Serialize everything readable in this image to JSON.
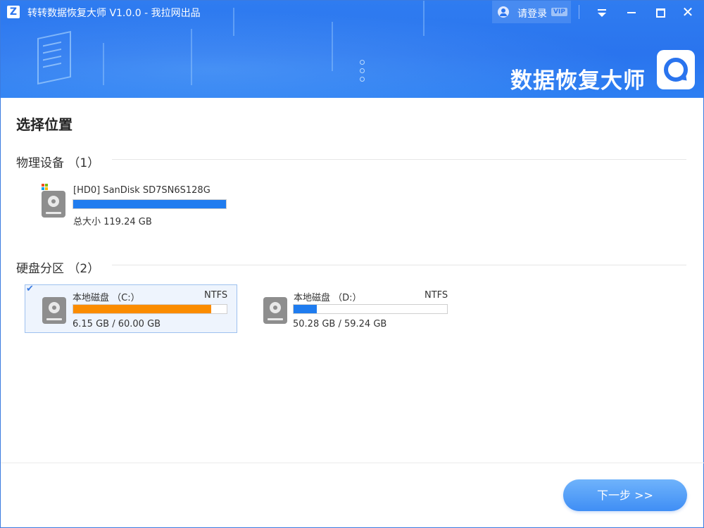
{
  "titlebar": {
    "logo_letter": "Z",
    "title": "转转数据恢复大师 V1.0.0 - 我拉网出品",
    "login_label": "请登录",
    "vip_badge": "VIP",
    "icons": [
      "menu-dropdown-icon",
      "minimize-icon",
      "maximize-icon",
      "close-icon"
    ],
    "close_glyph": "✕"
  },
  "banner": {
    "brand_text": "数据恢复大师",
    "accent_color": "#2a74ee"
  },
  "page": {
    "title": "选择位置"
  },
  "physical": {
    "section_label": "物理设备 （1）",
    "devices": [
      {
        "name": "[HD0] SanDisk SD7SN6S128G",
        "size_label": "总大小 119.24 GB",
        "used_fraction": 1.0,
        "bar_color": "#1f7cef"
      }
    ]
  },
  "partitions": {
    "section_label": "硬盘分区 （2）",
    "items": [
      {
        "name": "本地磁盘 （C:）",
        "fs": "NTFS",
        "size_label": "6.15 GB / 60.00 GB",
        "used_fraction": 0.898,
        "bar_color": "#fb8c00",
        "selected": true
      },
      {
        "name": "本地磁盘 （D:）",
        "fs": "NTFS",
        "size_label": "50.28 GB / 59.24 GB",
        "used_fraction": 0.15,
        "bar_color": "#1f7cef",
        "selected": false
      }
    ]
  },
  "footer": {
    "next_label": "下一步 >>"
  }
}
